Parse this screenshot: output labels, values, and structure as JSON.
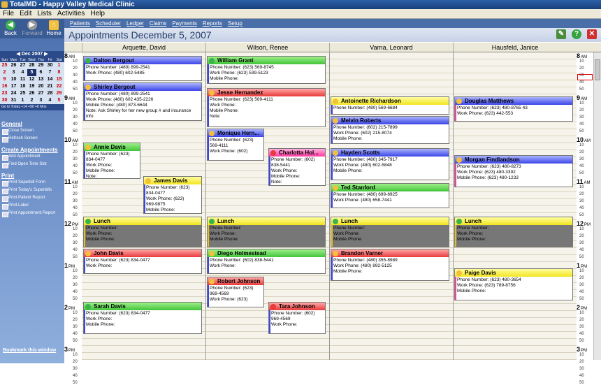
{
  "window_title": "TotalMD - Happy Valley Medical Clinic",
  "menu": [
    "File",
    "Edit",
    "Lists",
    "Activities",
    "Help"
  ],
  "toolbar": {
    "back": "Back",
    "forward": "Forward",
    "home": "Home"
  },
  "nav": [
    "Patients",
    "Scheduler",
    "Ledger",
    "Claims",
    "Payments",
    "Reports",
    "Setup"
  ],
  "page_title": "Appointments December 5, 2007",
  "calendar": {
    "month": "Dec 2007",
    "days": [
      "Sun",
      "Mon",
      "Tue",
      "Wed",
      "Thu",
      "Fri",
      "Sat"
    ],
    "weeks": [
      [
        "25",
        "26",
        "27",
        "28",
        "29",
        "30",
        "1"
      ],
      [
        "2",
        "3",
        "4",
        "5",
        "6",
        "7",
        "8"
      ],
      [
        "9",
        "10",
        "11",
        "12",
        "13",
        "14",
        "15"
      ],
      [
        "16",
        "17",
        "18",
        "19",
        "20",
        "21",
        "22"
      ],
      [
        "23",
        "24",
        "25",
        "26",
        "27",
        "28",
        "29"
      ],
      [
        "30",
        "31",
        "1",
        "2",
        "3",
        "4",
        "5"
      ]
    ],
    "footer": "Go to Today  +14  +90  +6 Mos"
  },
  "sidebar": {
    "general": "General",
    "general_items": [
      "Close Screen",
      "Refresh Screen"
    ],
    "create": "Create Appointments",
    "create_items": [
      "Add Appointment",
      "Find Open Time Slot"
    ],
    "print": "Print",
    "print_items": [
      "Print Superbill Form",
      "Print Today's Superbills",
      "Print Patient Report",
      "Print Label",
      "Print Appointment Report"
    ],
    "bookmark": "Bookmark this window"
  },
  "providers": [
    "Arquette, David",
    "Wilson, Renee",
    "Varna, Leonard",
    "Hausfeld, Janice"
  ],
  "hours": [
    {
      "h": "8",
      "ap": "AM"
    },
    {
      "h": "9",
      "ap": "AM"
    },
    {
      "h": "10",
      "ap": "AM"
    },
    {
      "h": "11",
      "ap": "AM"
    },
    {
      "h": "12",
      "ap": "PM"
    },
    {
      "h": "1",
      "ap": "PM"
    },
    {
      "h": "2",
      "ap": "PM"
    },
    {
      "h": "3",
      "ap": "PM"
    }
  ],
  "minutes": [
    "10",
    "20",
    "30",
    "40",
    "50"
  ],
  "appointments": [
    {
      "id": "a1",
      "name": "Dalton Bergout",
      "lines": [
        "Phone Number: (480) 899-2541",
        "Work Phone: (480) 602-5485"
      ]
    },
    {
      "id": "a2",
      "name": "Shirley Bergout",
      "lines": [
        "Phone Number: (480) 899-2541",
        "Work Phone: (480) 602 435-2226",
        "Mobile Phone: (480) 873-6644",
        "Note: Ask Shirley for her new group # and insurance info"
      ]
    },
    {
      "id": "a3",
      "name": "Annie Davis",
      "lines": [
        "Phone Number: (623)",
        "834-0477",
        "Work Phone:",
        "Mobile Phone:",
        "Note:"
      ]
    },
    {
      "id": "a4",
      "name": "James Davis",
      "lines": [
        "Phone Number: (623)",
        "834-0477",
        "Work Phone: (623)",
        "969-9875",
        "Mobile Phone:"
      ]
    },
    {
      "id": "a5",
      "name": "Lunch",
      "lines": [
        "Phone Number:",
        "Work Phone:",
        "Mobile Phone:"
      ]
    },
    {
      "id": "a6",
      "name": "John Davis",
      "lines": [
        "Phone Number: (623) 834-0477",
        "Work Phone:"
      ]
    },
    {
      "id": "a7",
      "name": "Sarah Davis",
      "lines": [
        "Phone Number: (623) 834-0477",
        "Work Phone:",
        "Mobile Phone:"
      ]
    },
    {
      "id": "b1",
      "name": "William Grant",
      "lines": [
        "Phone Number: (623) 569-8745",
        "Work Phone: (623) 539-5123",
        "Mobile Phone:"
      ]
    },
    {
      "id": "b2",
      "name": "Jesse Hernandez",
      "lines": [
        "Phone Number: (623) 569-4111",
        "Work Phone:",
        "Mobile Phone:",
        "Note:"
      ]
    },
    {
      "id": "b3",
      "name": "Monique Hern...",
      "lines": [
        "Phone Number: (623)",
        "569-4111",
        "Work Phone: (602)"
      ]
    },
    {
      "id": "b4",
      "name": "Charlotta Hol...",
      "lines": [
        "Phone Number: (602)",
        "838-5441",
        "Work Phone:",
        "Mobile Phone:",
        "Note:"
      ]
    },
    {
      "id": "b5",
      "name": "Lunch",
      "lines": [
        "Phone Number:",
        "Work Phone:",
        "Mobile Phone:"
      ]
    },
    {
      "id": "b6",
      "name": "Diego Holmestead",
      "lines": [
        "Phone Number: (602) 838-5441",
        "Work Phone:"
      ]
    },
    {
      "id": "b7",
      "name": "Robert Johnson",
      "lines": [
        "Phone Number: (623)",
        "969-4569",
        "Work Phone: (623)"
      ]
    },
    {
      "id": "b8",
      "name": "Tara Johnson",
      "lines": [
        "Phone Number: (602)",
        "969-4569",
        "Work Phone:"
      ]
    },
    {
      "id": "c1",
      "name": "Antoinette Richardson",
      "lines": [
        "Phone Number: (480) 569-6684"
      ]
    },
    {
      "id": "c2",
      "name": "Melvin Roberts",
      "lines": [
        "Phone Number: (602) 215-7899",
        "Work Phone: (602) 215-8074",
        "Mobile Phone:"
      ]
    },
    {
      "id": "c3",
      "name": "Hayden Scotts",
      "lines": [
        "Phone Number: (480) 345-7917",
        "Work Phone: (480) 602-5848",
        "Mobile Phone:"
      ]
    },
    {
      "id": "c4",
      "name": "Ted Stanford",
      "lines": [
        "Phone Number: (480) 699-8925",
        "Work Phone: (480) 658-7441"
      ]
    },
    {
      "id": "c5",
      "name": "Lunch",
      "lines": [
        "Phone Number:",
        "Work Phone:",
        "Mobile Phone:"
      ]
    },
    {
      "id": "c6",
      "name": "Brandon Varner",
      "lines": [
        "Phone Number: (480) 355-8989",
        "Work Phone: (480) 892-5125",
        "Mobile Phone:"
      ]
    },
    {
      "id": "d1",
      "name": "Douglas Matthews",
      "lines": [
        "Phone Number: (623) 480-8765 43",
        "Work Phone: (623) 442-553"
      ]
    },
    {
      "id": "d2",
      "name": "Morgan Findlandson",
      "lines": [
        "Phone Number: (623) 480-8273",
        "Work Phone: (623) 480-3392",
        "Mobile Phone: (623) 480-1233"
      ]
    },
    {
      "id": "d3",
      "name": "Lunch",
      "lines": [
        "Phone Number:",
        "Work Phone:",
        "Mobile Phone:"
      ]
    },
    {
      "id": "d4",
      "name": "Paige Davis",
      "lines": [
        "Phone Number: (623) 480-3654",
        "Work Phone: (623) 789-8756",
        "Mobile Phone:"
      ]
    }
  ]
}
